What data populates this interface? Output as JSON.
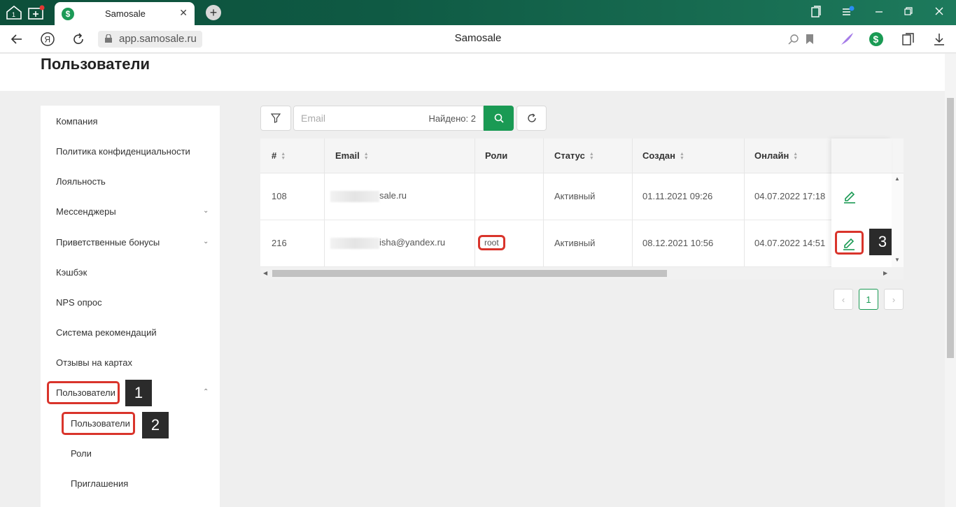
{
  "browser": {
    "tab_title": "Samosale",
    "tab_close": "✕",
    "new_tab": "+",
    "url": "app.samosale.ru",
    "page_title": "Samosale"
  },
  "page": {
    "title": "Пользователи"
  },
  "sidebar": {
    "items": [
      {
        "label": "Компания"
      },
      {
        "label": "Политика конфиденциальности"
      },
      {
        "label": "Лояльность"
      },
      {
        "label": "Мессенджеры",
        "chevron": "down"
      },
      {
        "label": "Приветственные бонусы",
        "chevron": "down"
      },
      {
        "label": "Кэшбэк"
      },
      {
        "label": "NPS опрос"
      },
      {
        "label": "Система рекомендаций"
      },
      {
        "label": "Отзывы на картах"
      },
      {
        "label": "Пользователи",
        "chevron": "up"
      }
    ],
    "sub_items": [
      {
        "label": "Пользователи"
      },
      {
        "label": "Роли"
      },
      {
        "label": "Приглашения"
      }
    ]
  },
  "annotations": [
    "1",
    "2",
    "3"
  ],
  "toolbar": {
    "search_placeholder": "Email",
    "found_text": "Найдено: 2"
  },
  "table": {
    "columns": [
      "#",
      "Email",
      "Роли",
      "Статус",
      "Создан",
      "Онлайн"
    ],
    "rows": [
      {
        "id": "108",
        "email": "sale.ru",
        "role": "",
        "status": "Активный",
        "created": "01.11.2021 09:26",
        "online": "04.07.2022 17:18"
      },
      {
        "id": "216",
        "email": "isha@yandex.ru",
        "role": "root",
        "status": "Активный",
        "created": "08.12.2021 10:56",
        "online": "04.07.2022 14:51"
      }
    ]
  },
  "pagination": {
    "prev": "‹",
    "current": "1",
    "next": "›"
  },
  "colors": {
    "brand_green": "#1a9a54",
    "highlight_red": "#d9342b"
  }
}
